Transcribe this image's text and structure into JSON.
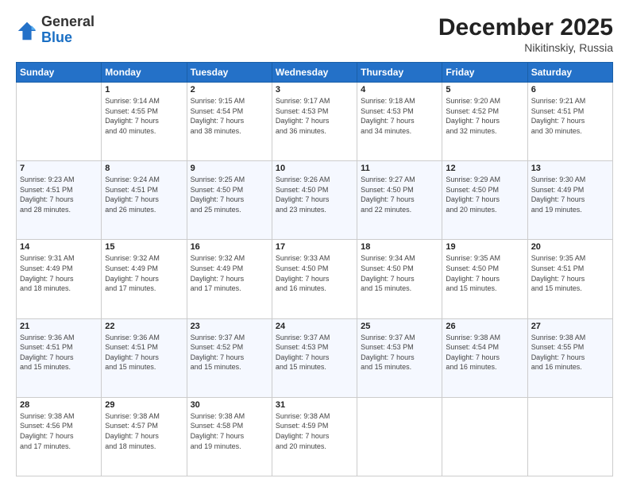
{
  "logo": {
    "general": "General",
    "blue": "Blue"
  },
  "title": {
    "month": "December 2025",
    "location": "Nikitinskiy, Russia"
  },
  "days_header": [
    "Sunday",
    "Monday",
    "Tuesday",
    "Wednesday",
    "Thursday",
    "Friday",
    "Saturday"
  ],
  "weeks": [
    [
      {
        "day": "",
        "info": ""
      },
      {
        "day": "1",
        "info": "Sunrise: 9:14 AM\nSunset: 4:55 PM\nDaylight: 7 hours\nand 40 minutes."
      },
      {
        "day": "2",
        "info": "Sunrise: 9:15 AM\nSunset: 4:54 PM\nDaylight: 7 hours\nand 38 minutes."
      },
      {
        "day": "3",
        "info": "Sunrise: 9:17 AM\nSunset: 4:53 PM\nDaylight: 7 hours\nand 36 minutes."
      },
      {
        "day": "4",
        "info": "Sunrise: 9:18 AM\nSunset: 4:53 PM\nDaylight: 7 hours\nand 34 minutes."
      },
      {
        "day": "5",
        "info": "Sunrise: 9:20 AM\nSunset: 4:52 PM\nDaylight: 7 hours\nand 32 minutes."
      },
      {
        "day": "6",
        "info": "Sunrise: 9:21 AM\nSunset: 4:51 PM\nDaylight: 7 hours\nand 30 minutes."
      }
    ],
    [
      {
        "day": "7",
        "info": "Sunrise: 9:23 AM\nSunset: 4:51 PM\nDaylight: 7 hours\nand 28 minutes."
      },
      {
        "day": "8",
        "info": "Sunrise: 9:24 AM\nSunset: 4:51 PM\nDaylight: 7 hours\nand 26 minutes."
      },
      {
        "day": "9",
        "info": "Sunrise: 9:25 AM\nSunset: 4:50 PM\nDaylight: 7 hours\nand 25 minutes."
      },
      {
        "day": "10",
        "info": "Sunrise: 9:26 AM\nSunset: 4:50 PM\nDaylight: 7 hours\nand 23 minutes."
      },
      {
        "day": "11",
        "info": "Sunrise: 9:27 AM\nSunset: 4:50 PM\nDaylight: 7 hours\nand 22 minutes."
      },
      {
        "day": "12",
        "info": "Sunrise: 9:29 AM\nSunset: 4:50 PM\nDaylight: 7 hours\nand 20 minutes."
      },
      {
        "day": "13",
        "info": "Sunrise: 9:30 AM\nSunset: 4:49 PM\nDaylight: 7 hours\nand 19 minutes."
      }
    ],
    [
      {
        "day": "14",
        "info": "Sunrise: 9:31 AM\nSunset: 4:49 PM\nDaylight: 7 hours\nand 18 minutes."
      },
      {
        "day": "15",
        "info": "Sunrise: 9:32 AM\nSunset: 4:49 PM\nDaylight: 7 hours\nand 17 minutes."
      },
      {
        "day": "16",
        "info": "Sunrise: 9:32 AM\nSunset: 4:49 PM\nDaylight: 7 hours\nand 17 minutes."
      },
      {
        "day": "17",
        "info": "Sunrise: 9:33 AM\nSunset: 4:50 PM\nDaylight: 7 hours\nand 16 minutes."
      },
      {
        "day": "18",
        "info": "Sunrise: 9:34 AM\nSunset: 4:50 PM\nDaylight: 7 hours\nand 15 minutes."
      },
      {
        "day": "19",
        "info": "Sunrise: 9:35 AM\nSunset: 4:50 PM\nDaylight: 7 hours\nand 15 minutes."
      },
      {
        "day": "20",
        "info": "Sunrise: 9:35 AM\nSunset: 4:51 PM\nDaylight: 7 hours\nand 15 minutes."
      }
    ],
    [
      {
        "day": "21",
        "info": "Sunrise: 9:36 AM\nSunset: 4:51 PM\nDaylight: 7 hours\nand 15 minutes."
      },
      {
        "day": "22",
        "info": "Sunrise: 9:36 AM\nSunset: 4:51 PM\nDaylight: 7 hours\nand 15 minutes."
      },
      {
        "day": "23",
        "info": "Sunrise: 9:37 AM\nSunset: 4:52 PM\nDaylight: 7 hours\nand 15 minutes."
      },
      {
        "day": "24",
        "info": "Sunrise: 9:37 AM\nSunset: 4:53 PM\nDaylight: 7 hours\nand 15 minutes."
      },
      {
        "day": "25",
        "info": "Sunrise: 9:37 AM\nSunset: 4:53 PM\nDaylight: 7 hours\nand 15 minutes."
      },
      {
        "day": "26",
        "info": "Sunrise: 9:38 AM\nSunset: 4:54 PM\nDaylight: 7 hours\nand 16 minutes."
      },
      {
        "day": "27",
        "info": "Sunrise: 9:38 AM\nSunset: 4:55 PM\nDaylight: 7 hours\nand 16 minutes."
      }
    ],
    [
      {
        "day": "28",
        "info": "Sunrise: 9:38 AM\nSunset: 4:56 PM\nDaylight: 7 hours\nand 17 minutes."
      },
      {
        "day": "29",
        "info": "Sunrise: 9:38 AM\nSunset: 4:57 PM\nDaylight: 7 hours\nand 18 minutes."
      },
      {
        "day": "30",
        "info": "Sunrise: 9:38 AM\nSunset: 4:58 PM\nDaylight: 7 hours\nand 19 minutes."
      },
      {
        "day": "31",
        "info": "Sunrise: 9:38 AM\nSunset: 4:59 PM\nDaylight: 7 hours\nand 20 minutes."
      },
      {
        "day": "",
        "info": ""
      },
      {
        "day": "",
        "info": ""
      },
      {
        "day": "",
        "info": ""
      }
    ]
  ]
}
